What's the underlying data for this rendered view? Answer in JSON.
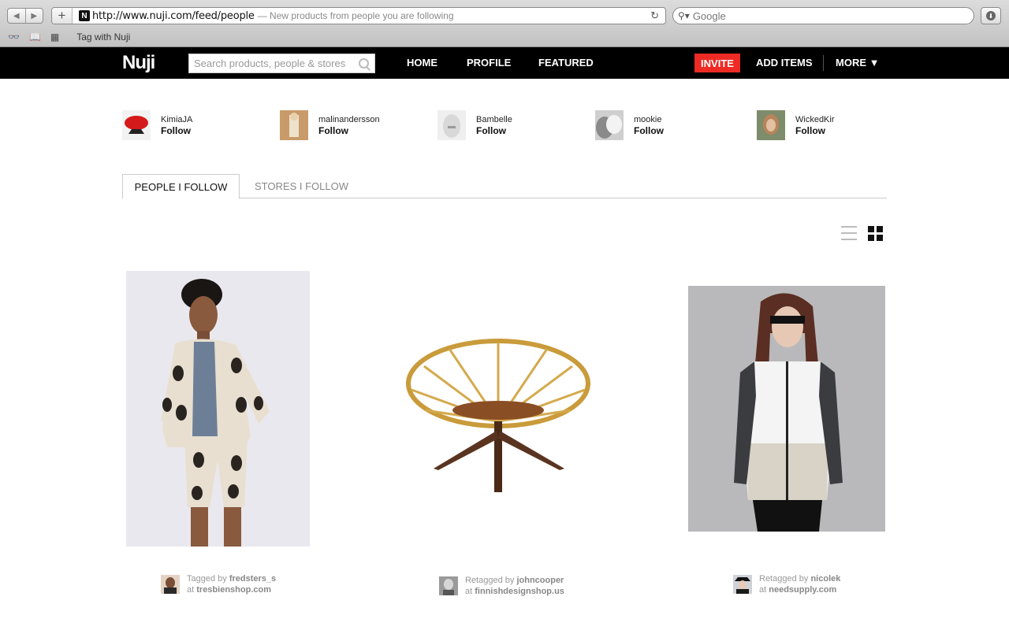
{
  "browser": {
    "url": "http://www.nuji.com/feed/people",
    "page_title": "— New products from people you are following",
    "search_placeholder": "Google",
    "bookmark": "Tag with Nuji",
    "favicon_letter": "N"
  },
  "site": {
    "logo": "Nuji",
    "search_placeholder": "Search products, people & stores",
    "nav": {
      "home": "HOME",
      "profile": "PROFILE",
      "featured": "FEATURED"
    },
    "invite": "INVITE",
    "add_items": "ADD ITEMS",
    "more": "MORE ▼"
  },
  "suggestions": [
    {
      "name": "KimiaJA",
      "action": "Follow"
    },
    {
      "name": "malinandersson",
      "action": "Follow"
    },
    {
      "name": "Bambelle",
      "action": "Follow"
    },
    {
      "name": "mookie",
      "action": "Follow"
    },
    {
      "name": "WickedKir",
      "action": "Follow"
    }
  ],
  "tabs": {
    "people": "PEOPLE I FOLLOW",
    "stores": "STORES I FOLLOW"
  },
  "products": [
    {
      "verb": "Tagged by",
      "user": "fredsters_s",
      "at": "at",
      "store": "tresbienshop.com"
    },
    {
      "verb": "Retagged by",
      "user": "johncooper",
      "at": "at",
      "store": "finnishdesignshop.us"
    },
    {
      "verb": "Retagged by",
      "user": "nicolek",
      "at": "at",
      "store": "needsupply.com"
    }
  ],
  "colors": {
    "invite": "#ee2a24",
    "nav_bg": "#000000"
  }
}
